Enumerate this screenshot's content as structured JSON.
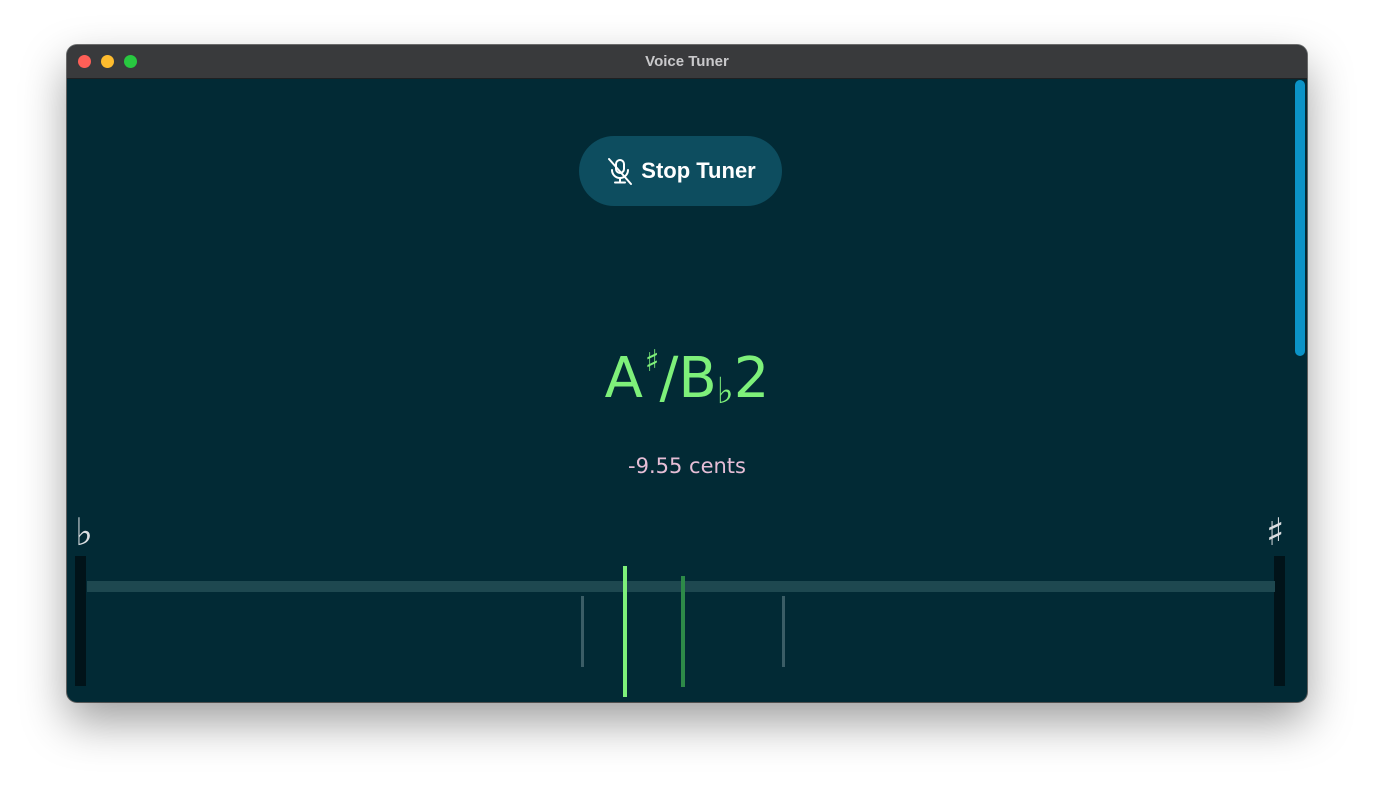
{
  "window": {
    "title": "Voice Tuner",
    "traffic_lights": {
      "close_color": "#fe5f57",
      "minimize_color": "#febc2e",
      "maximize_color": "#28c840"
    }
  },
  "toolbar": {
    "stop_label": "Stop Tuner",
    "stop_icon": "mic-off-icon"
  },
  "tuner": {
    "note_letter": "A",
    "note_sharp": "♯",
    "note_slash": "/B",
    "note_flat": "♭",
    "note_octave": "2",
    "cents_text": "-9.55 cents",
    "cents_value": -9.55,
    "flat_symbol": "♭",
    "sharp_symbol": "♯"
  },
  "meter": {
    "range_cents": [
      -50,
      50
    ],
    "reference_cents": 0,
    "reference_color": "#2d8a48",
    "needle_cents": -9.55,
    "needle_color": "#7ef07a",
    "bound_markers_cents": [
      -16.5,
      16.5
    ],
    "bound_color": "#3b5d66",
    "track_color": "#1e4850",
    "background_color": "#022a35",
    "accent_color": "#0d4d5f"
  }
}
